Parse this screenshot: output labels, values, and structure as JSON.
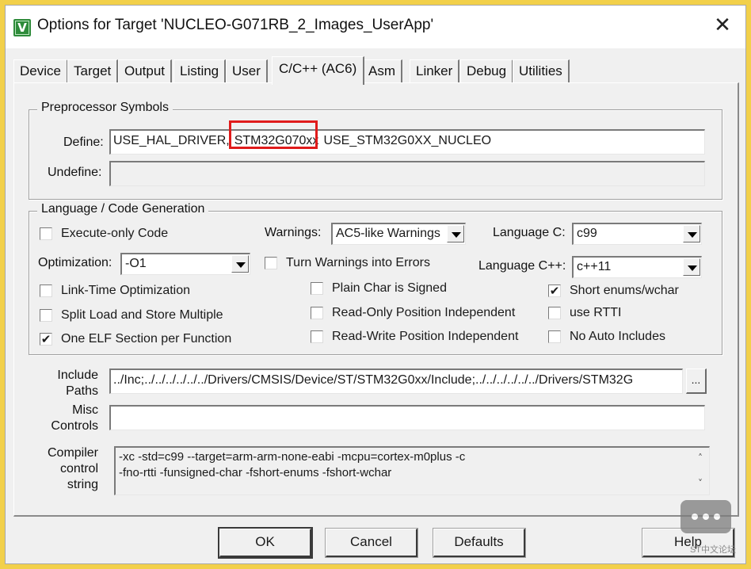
{
  "window": {
    "title": "Options for Target 'NUCLEO-G071RB_2_Images_UserApp'",
    "close_glyph": "✕"
  },
  "app_icon": {
    "name": "keil-uvision-icon",
    "glyph": "V"
  },
  "tabs": [
    {
      "label": "Device",
      "active": false
    },
    {
      "label": "Target",
      "active": false
    },
    {
      "label": "Output",
      "active": false
    },
    {
      "label": "Listing",
      "active": false
    },
    {
      "label": "User",
      "active": false
    },
    {
      "label": "C/C++ (AC6)",
      "active": true
    },
    {
      "label": "Asm",
      "active": false
    },
    {
      "label": "Linker",
      "active": false
    },
    {
      "label": "Debug",
      "active": false
    },
    {
      "label": "Utilities",
      "active": false
    }
  ],
  "preprocessor": {
    "legend": "Preprocessor Symbols",
    "define_label": "Define:",
    "define_value_1": "USE_HAL_DRIVER,",
    "define_value_2": "STM32G070xx",
    "define_value_3": "USE_STM32G0XX_NUCLEO",
    "undefine_label": "Undefine:",
    "undefine_value": ""
  },
  "language": {
    "legend": "Language / Code Generation",
    "execute_only": {
      "label": "Execute-only Code",
      "checked": false
    },
    "warnings_label": "Warnings:",
    "warnings_value": "AC5-like Warnings",
    "language_c_label": "Language C:",
    "language_c_value": "c99",
    "optimization_label": "Optimization:",
    "optimization_value": "-O1",
    "turn_warnings": {
      "label": "Turn Warnings into Errors",
      "checked": false
    },
    "language_cpp_label": "Language C++:",
    "language_cpp_value": "c++11",
    "lto": {
      "label": "Link-Time Optimization",
      "checked": false
    },
    "plain_char": {
      "label": "Plain Char is Signed",
      "checked": false
    },
    "short_enums": {
      "label": "Short enums/wchar",
      "checked": true
    },
    "split_load": {
      "label": "Split Load and Store Multiple",
      "checked": false
    },
    "ro_pi": {
      "label": "Read-Only Position Independent",
      "checked": false
    },
    "use_rtti": {
      "label": "use RTTI",
      "checked": false
    },
    "one_elf": {
      "label": "One ELF Section per Function",
      "checked": true
    },
    "rw_pi": {
      "label": "Read-Write Position Independent",
      "checked": false
    },
    "no_auto_includes": {
      "label": "No Auto Includes",
      "checked": false
    }
  },
  "include": {
    "label_line1": "Include",
    "label_line2": "Paths",
    "value": "../Inc;../../../../../../Drivers/CMSIS/Device/ST/STM32G0xx/Include;../../../../../../Drivers/STM32G",
    "browse_label": "..."
  },
  "misc": {
    "label_line1": "Misc",
    "label_line2": "Controls",
    "value": ""
  },
  "compiler": {
    "label_line1": "Compiler",
    "label_line2": "control",
    "label_line3": "string",
    "line1": "-xc -std=c99 --target=arm-arm-none-eabi -mcpu=cortex-m0plus -c",
    "line2": "-fno-rtti -funsigned-char -fshort-enums -fshort-wchar",
    "scroll_up": "˄",
    "scroll_down": "˅"
  },
  "buttons": {
    "ok": "OK",
    "cancel": "Cancel",
    "defaults": "Defaults",
    "help": "Help"
  },
  "watermark": {
    "text": "ST中文论坛",
    "icon": "chat-bubble-icon"
  },
  "colors": {
    "highlight": "#e01b1b",
    "frame": "#f2d04a"
  }
}
